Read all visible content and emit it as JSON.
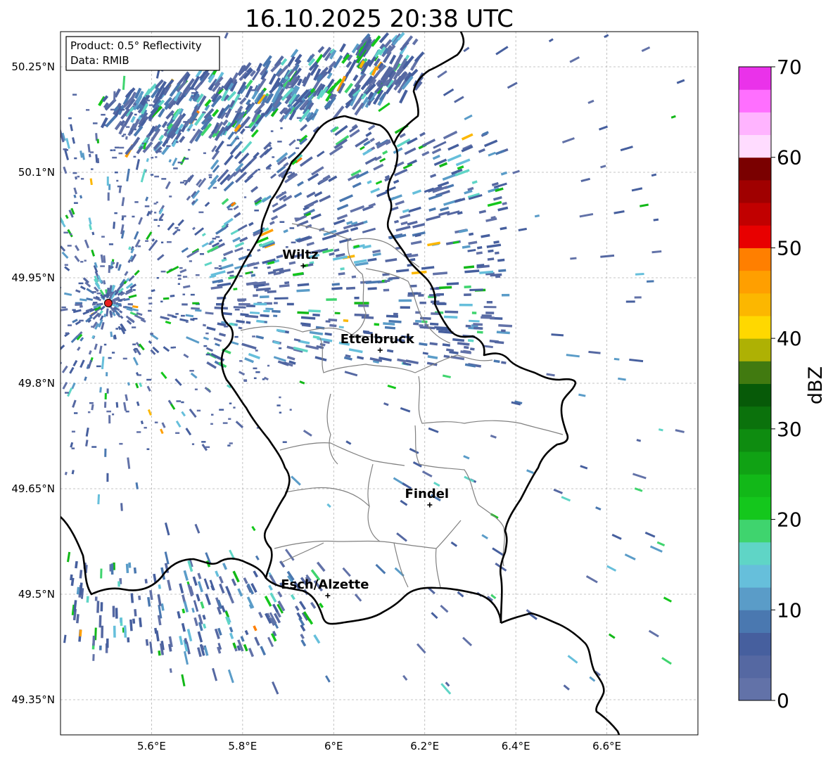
{
  "title": "16.10.2025 20:38 UTC",
  "info_box": {
    "product": "Product: 0.5° Reflectivity",
    "data": "Data: RMIB"
  },
  "lat_ticks": [
    {
      "value": 50.25,
      "label": "50.25°N"
    },
    {
      "value": 50.1,
      "label": "50.1°N"
    },
    {
      "value": 49.95,
      "label": "49.95°N"
    },
    {
      "value": 49.8,
      "label": "49.8°N"
    },
    {
      "value": 49.65,
      "label": "49.65°N"
    },
    {
      "value": 49.5,
      "label": "49.5°N"
    },
    {
      "value": 49.35,
      "label": "49.35°N"
    }
  ],
  "lon_ticks": [
    {
      "value": 5.6,
      "label": "5.6°E"
    },
    {
      "value": 5.8,
      "label": "5.8°E"
    },
    {
      "value": 6.0,
      "label": "6°E"
    },
    {
      "value": 6.2,
      "label": "6.2°E"
    },
    {
      "value": 6.4,
      "label": "6.4°E"
    },
    {
      "value": 6.6,
      "label": "6.6°E"
    }
  ],
  "map_extent": {
    "lon_min": 5.4,
    "lon_max": 6.8,
    "lat_min": 49.3,
    "lat_max": 50.3
  },
  "radar_site": {
    "lon": 5.505,
    "lat": 49.914
  },
  "cities": [
    {
      "name": "Wiltz",
      "lon": 5.933,
      "lat": 49.967
    },
    {
      "name": "Ettelbruck",
      "lon": 6.102,
      "lat": 49.847
    },
    {
      "name": "Findel",
      "lon": 6.211,
      "lat": 49.627
    },
    {
      "name": "Esch/Alzette",
      "lon": 5.987,
      "lat": 49.498
    }
  ],
  "colorbar": {
    "label": "dBZ",
    "min": 0,
    "max": 70,
    "ticks": [
      {
        "value": 0,
        "label": "0"
      },
      {
        "value": 10,
        "label": "10"
      },
      {
        "value": 20,
        "label": "20"
      },
      {
        "value": 30,
        "label": "30"
      },
      {
        "value": 40,
        "label": "40"
      },
      {
        "value": 50,
        "label": "50"
      },
      {
        "value": 60,
        "label": "60"
      },
      {
        "value": 70,
        "label": "70"
      }
    ],
    "colors": [
      "#6272a8",
      "#5568a2",
      "#465f9e",
      "#4a78b0",
      "#5a9cc8",
      "#66bfdb",
      "#5fd5c6",
      "#3fd46e",
      "#14c71c",
      "#12b818",
      "#10a214",
      "#0e8c10",
      "#0b720c",
      "#075a08",
      "#417a10",
      "#aeb104",
      "#ffd800",
      "#fcb700",
      "#ff9f00",
      "#ff7f00",
      "#e80000",
      "#c10000",
      "#a00000",
      "#7a0000",
      "#ffdcff",
      "#ffb4ff",
      "#ff6fff",
      "#ea32ea"
    ]
  },
  "colors": {
    "border": "#000000",
    "canton": "#808080",
    "grid": "#b4b4b4",
    "radar_marker": "#e82020"
  }
}
